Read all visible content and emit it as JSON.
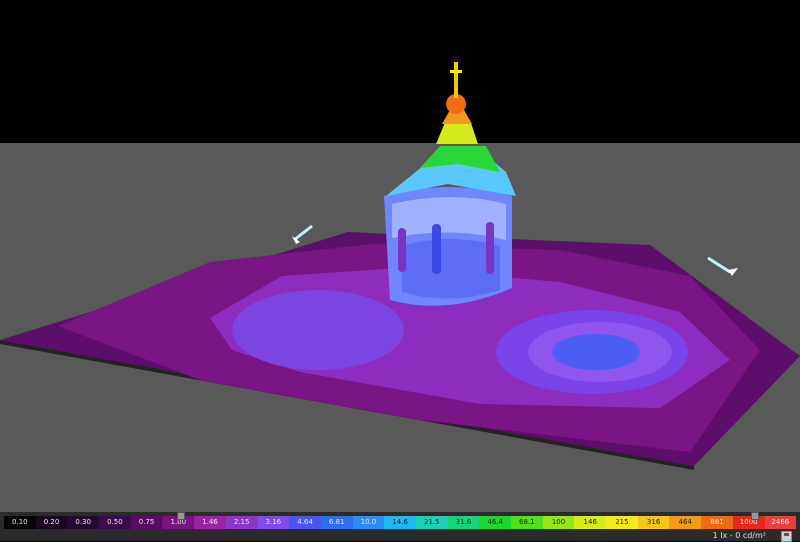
{
  "legend": {
    "entries": [
      {
        "label": "0.10",
        "color": "#050508"
      },
      {
        "label": "0.20",
        "color": "#1a0820"
      },
      {
        "label": "0.30",
        "color": "#260a33"
      },
      {
        "label": "0.50",
        "color": "#3d0a4d"
      },
      {
        "label": "0.75",
        "color": "#5a0c63"
      },
      {
        "label": "1.00",
        "color": "#7a1380"
      },
      {
        "label": "1.46",
        "color": "#9b23a6"
      },
      {
        "label": "2.15",
        "color": "#8a37c9"
      },
      {
        "label": "3.16",
        "color": "#7e4ce6"
      },
      {
        "label": "4.64",
        "color": "#4b55f2"
      },
      {
        "label": "6.81",
        "color": "#2f6df5"
      },
      {
        "label": "10.0",
        "color": "#2a8ef2"
      },
      {
        "label": "14.6",
        "color": "#20b8f0"
      },
      {
        "label": "21.5",
        "color": "#1ccfb8"
      },
      {
        "label": "31.6",
        "color": "#19d37a"
      },
      {
        "label": "46.4",
        "color": "#1fd62e"
      },
      {
        "label": "68.1",
        "color": "#52de1a"
      },
      {
        "label": "100",
        "color": "#95e61a"
      },
      {
        "label": "146",
        "color": "#d4ec1d"
      },
      {
        "label": "215",
        "color": "#f3ea1c"
      },
      {
        "label": "316",
        "color": "#f6c51a"
      },
      {
        "label": "464",
        "color": "#f39b18"
      },
      {
        "label": "681",
        "color": "#ee6c16"
      },
      {
        "label": "1000",
        "color": "#e8281a"
      },
      {
        "label": "2466",
        "color": "#e84040"
      }
    ],
    "status_text": "1 lx - 0 cd/m²"
  }
}
